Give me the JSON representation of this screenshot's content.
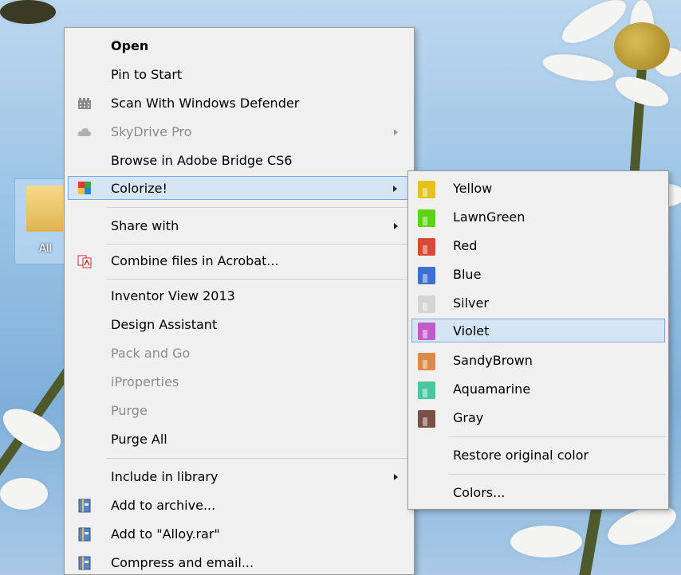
{
  "desktop": {
    "icon_label": "All"
  },
  "menu": {
    "items": [
      {
        "label": "Open"
      },
      {
        "label": "Pin to Start"
      },
      {
        "label": "Scan With Windows Defender"
      },
      {
        "label": "SkyDrive Pro"
      },
      {
        "label": "Browse in Adobe Bridge CS6"
      },
      {
        "label": "Colorize!"
      },
      {
        "label": "Share with"
      },
      {
        "label": "Combine files in Acrobat..."
      },
      {
        "label": "Inventor View 2013"
      },
      {
        "label": "Design Assistant"
      },
      {
        "label": "Pack and Go"
      },
      {
        "label": "iProperties"
      },
      {
        "label": "Purge"
      },
      {
        "label": "Purge All"
      },
      {
        "label": "Include in library"
      },
      {
        "label": "Add to archive..."
      },
      {
        "label": "Add to \"Alloy.rar\""
      },
      {
        "label": "Compress and email..."
      }
    ]
  },
  "submenu": {
    "items": [
      {
        "label": "Yellow",
        "color": "#e8c21c"
      },
      {
        "label": "LawnGreen",
        "color": "#5dd216"
      },
      {
        "label": "Red",
        "color": "#d84a35"
      },
      {
        "label": "Blue",
        "color": "#3f6fd0"
      },
      {
        "label": "Silver",
        "color": "#d4d4d4"
      },
      {
        "label": "Violet",
        "color": "#c459c8"
      },
      {
        "label": "SandyBrown",
        "color": "#dc8a45"
      },
      {
        "label": "Aquamarine",
        "color": "#49c8a0"
      },
      {
        "label": "Gray",
        "color": "#7a4f45"
      },
      {
        "label": "Restore original color"
      },
      {
        "label": "Colors..."
      }
    ]
  }
}
